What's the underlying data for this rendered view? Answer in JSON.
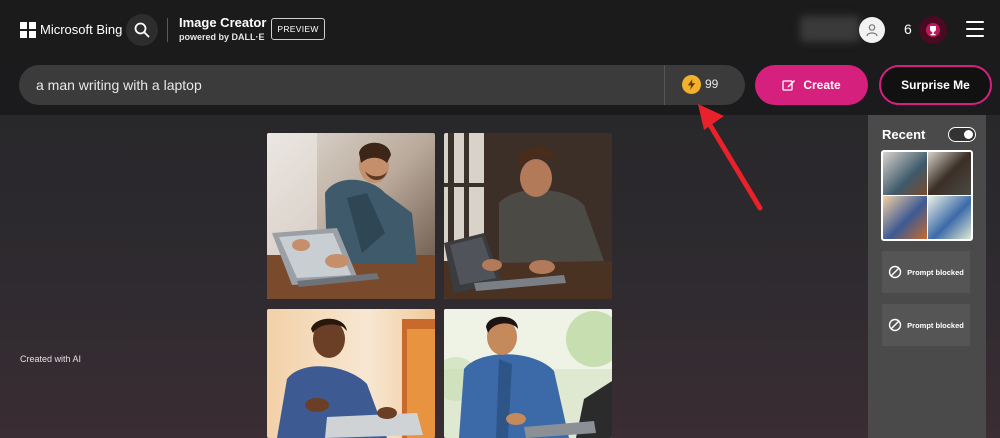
{
  "header": {
    "brand": "Microsoft Bing",
    "title": "Image Creator",
    "subtitle": "powered by DALL·E",
    "preview_badge": "PREVIEW",
    "reward_count": "6"
  },
  "prompt": {
    "value": "a man writing with a laptop",
    "boost_count": "99"
  },
  "actions": {
    "create_label": "Create",
    "surprise_label": "Surprise Me"
  },
  "footer": {
    "created_with": "Created with AI"
  },
  "recent": {
    "title": "Recent",
    "items": [
      {
        "label": "Prompt blocked"
      },
      {
        "label": "Prompt blocked"
      }
    ]
  },
  "colors": {
    "accent": "#d6207e",
    "boost": "#f1b02e",
    "annotation_arrow": "#e8212b"
  }
}
